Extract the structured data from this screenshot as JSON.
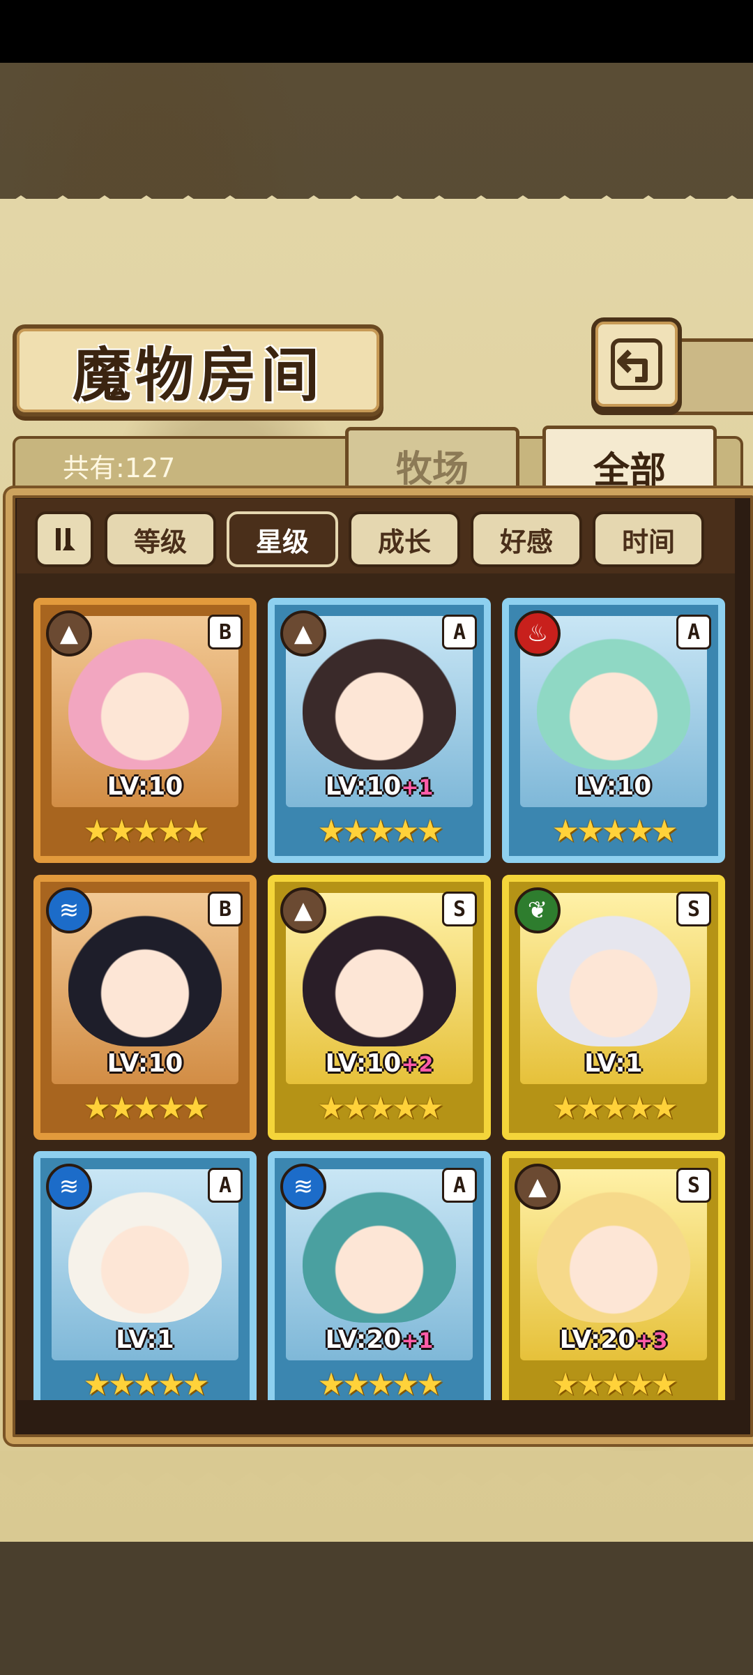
{
  "title": "魔物房间",
  "count_label": "共有:127",
  "tabs": {
    "ranch": "牧场",
    "all": "全部"
  },
  "sort": {
    "toggle_icon": "sort-order-icon",
    "buttons": [
      "等级",
      "星级",
      "成长",
      "好感",
      "时间"
    ],
    "active_index": 1
  },
  "cards": [
    {
      "element": "earth",
      "rank": "B",
      "level": "LV:10",
      "plus": "",
      "stars": "★★★★★",
      "hair": "#f2a6c0"
    },
    {
      "element": "earth",
      "rank": "A",
      "level": "LV:10",
      "plus": "+1",
      "stars": "★★★★★",
      "hair": "#3a2a2a"
    },
    {
      "element": "fire",
      "rank": "A",
      "level": "LV:10",
      "plus": "",
      "stars": "★★★★★",
      "hair": "#8fd8c4"
    },
    {
      "element": "water",
      "rank": "B",
      "level": "LV:10",
      "plus": "",
      "stars": "★★★★★",
      "hair": "#1e1e2a"
    },
    {
      "element": "earth",
      "rank": "S",
      "level": "LV:10",
      "plus": "+2",
      "stars": "★★★★★",
      "hair": "#2a1e28"
    },
    {
      "element": "wind",
      "rank": "S",
      "level": "LV:1",
      "plus": "",
      "stars": "★★★★★",
      "hair": "#e6e6ee"
    },
    {
      "element": "water",
      "rank": "A",
      "level": "LV:1",
      "plus": "",
      "stars": "★★★★★",
      "hair": "#f6f2ea"
    },
    {
      "element": "water",
      "rank": "A",
      "level": "LV:20",
      "plus": "+1",
      "stars": "★★★★★",
      "hair": "#4aa0a0"
    },
    {
      "element": "earth",
      "rank": "S",
      "level": "LV:20",
      "plus": "+3",
      "stars": "★★★★★",
      "hair": "#f6d98a"
    }
  ],
  "colors": {
    "tier_B": "#e29a3c",
    "tier_A": "#8ed0ef",
    "tier_S": "#f4d53a",
    "star": "#ffd23a",
    "plus": "#ff5ca8"
  }
}
